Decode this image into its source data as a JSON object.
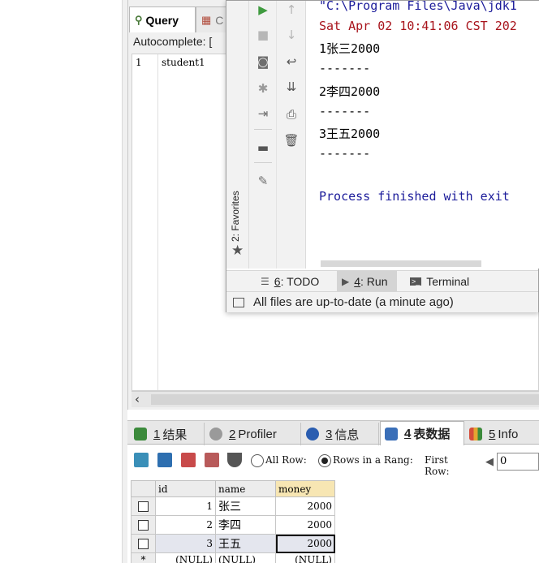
{
  "left_panel": {},
  "query_editor": {
    "tabs": [
      {
        "label": "Query",
        "icon": "query-tab-icon"
      },
      {
        "label": "C",
        "icon": "table-tab-icon"
      }
    ],
    "autocomplete_label": "Autocomplete: [",
    "lines": [
      {
        "num": "1",
        "text": "student1"
      }
    ]
  },
  "ide": {
    "favorites_label": "2: Favorites",
    "console": [
      {
        "text": "\"C:\\Program Files\\Java\\jdk1",
        "kind": "cmd"
      },
      {
        "text": "Sat Apr 02 10:41:06 CST 202",
        "kind": "err"
      },
      {
        "text": "1张三2000",
        "kind": "out"
      },
      {
        "text": "-------",
        "kind": "out"
      },
      {
        "text": "2李四2000",
        "kind": "out"
      },
      {
        "text": "-------",
        "kind": "out"
      },
      {
        "text": "3王五2000",
        "kind": "out"
      },
      {
        "text": "-------",
        "kind": "out"
      },
      {
        "text": "",
        "kind": "out"
      },
      {
        "text": "Process finished with exit",
        "kind": "proc"
      }
    ],
    "bottom_tabs": [
      {
        "num": "6",
        "label": ": TODO",
        "icon": "list-icon"
      },
      {
        "num": "4",
        "label": ": Run",
        "icon": "run-icon"
      },
      {
        "num": "",
        "label": "Terminal",
        "icon": "terminal-icon"
      }
    ],
    "status_text": "All files are up-to-date (a minute ago)"
  },
  "results": {
    "tabs": [
      {
        "num": "1",
        "label": "结果",
        "icon_color": "#3b8a3b"
      },
      {
        "num": "2",
        "label": "Profiler",
        "icon_color": "#7a7a7a"
      },
      {
        "num": "3",
        "label": "信息",
        "icon_color": "#2a5db0"
      },
      {
        "num": "4",
        "label": "表数据",
        "icon_color": "#3a6fb8"
      },
      {
        "num": "5",
        "label": "Info",
        "icon_color": "#d64d3a"
      }
    ],
    "toolbar": {
      "all_rows_label": "All Row:",
      "rows_in_range_label": "Rows in a Rang:",
      "first_row_label": "First Row:",
      "first_row_value": "0"
    },
    "grid": {
      "columns": [
        "id",
        "name",
        "money"
      ],
      "rows": [
        {
          "id": "1",
          "name": "张三",
          "money": "2000"
        },
        {
          "id": "2",
          "name": "李四",
          "money": "2000"
        },
        {
          "id": "3",
          "name": "王五",
          "money": "2000"
        }
      ],
      "new_row": {
        "marker": "*",
        "id": "(NULL)",
        "name": "(NULL)",
        "money": "(NULL)"
      }
    }
  }
}
